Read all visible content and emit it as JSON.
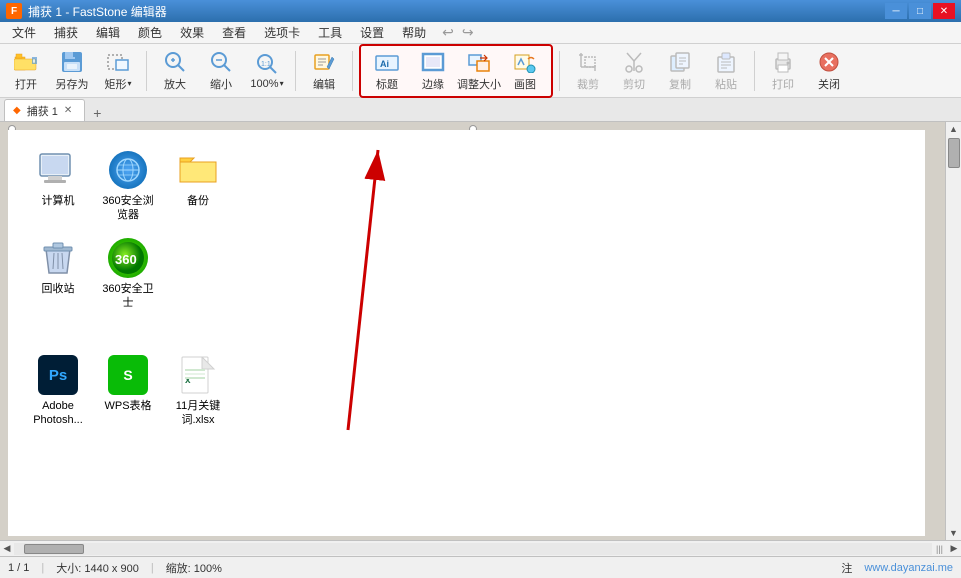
{
  "titleBar": {
    "title": "捕获 1 - FastStone 编辑器",
    "minBtn": "─",
    "maxBtn": "□",
    "closeBtn": "✕"
  },
  "menuBar": {
    "items": [
      "文件",
      "捕获",
      "编辑",
      "颜色",
      "效果",
      "查看",
      "选项卡",
      "工具",
      "设置",
      "帮助"
    ]
  },
  "toolbar": {
    "open": "打开",
    "saveAs": "另存为",
    "rect": "矩形",
    "zoomIn": "放大",
    "zoomOut": "缩小",
    "zoom100": "100%",
    "edit": "编辑",
    "label": "标题",
    "border": "边缘",
    "resize": "调整大小",
    "draw": "画图",
    "crop": "裁剪",
    "cut": "剪切",
    "copy": "复制",
    "paste": "粘贴",
    "print": "打印",
    "close": "关闭"
  },
  "tabs": {
    "tab1": "捕获 1",
    "addBtn": "+"
  },
  "canvas": {
    "icons": [
      {
        "label": "计算机",
        "type": "computer"
      },
      {
        "label": "360安全浏览器",
        "type": "browser360"
      },
      {
        "label": "备份",
        "type": "folder"
      }
    ],
    "icons2": [
      {
        "label": "回收站",
        "type": "recycle"
      },
      {
        "label": "360安全卫士",
        "type": "360guard"
      }
    ],
    "icons3": [
      {
        "label": "Adobe Photosh...",
        "type": "photoshop"
      },
      {
        "label": "WPS表格",
        "type": "wps"
      },
      {
        "label": "11月关键词.xlsx",
        "type": "excel"
      }
    ]
  },
  "statusBar": {
    "page": "1 / 1",
    "size": "大小: 1440 x 900",
    "zoom": "缩放: 100%",
    "note": "注",
    "website": "www.dayanzai.me"
  }
}
